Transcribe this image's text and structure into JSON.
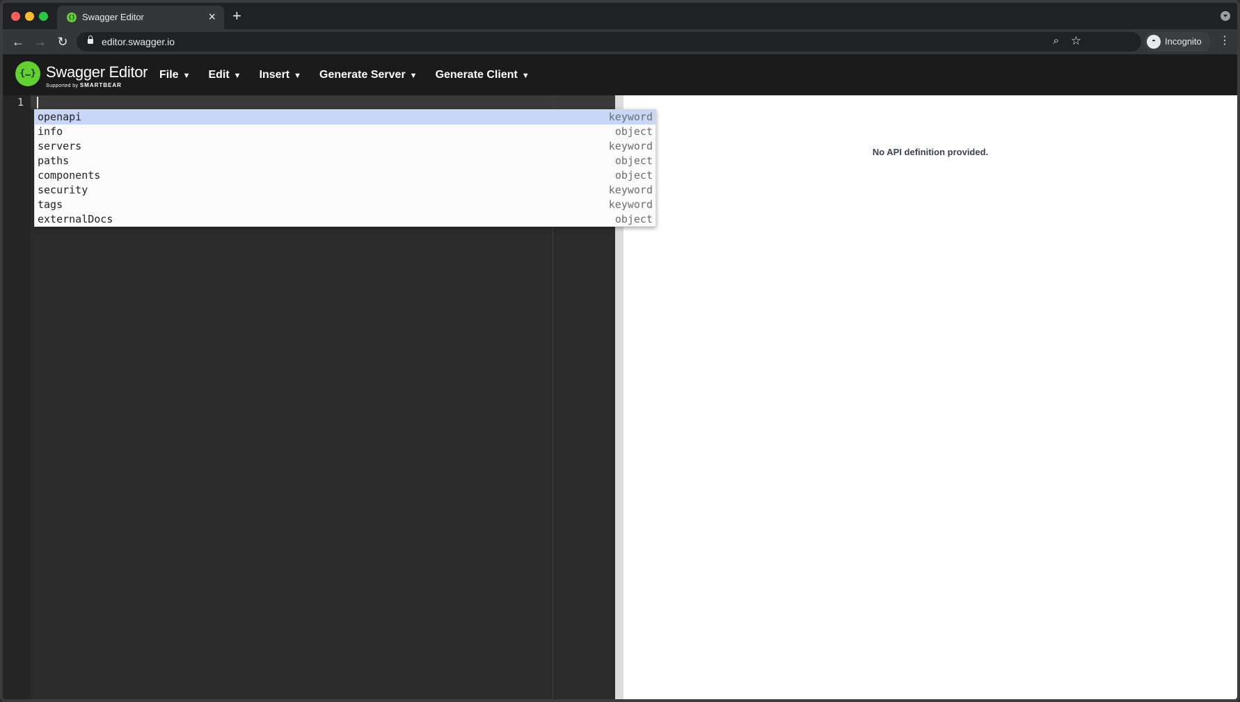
{
  "browser": {
    "tab_title": "Swagger Editor",
    "tab_favicon_glyph": "{}",
    "tab_close_glyph": "×",
    "new_tab_glyph": "+",
    "url": "editor.swagger.io",
    "incognito_label": "Incognito",
    "nav": {
      "back": "←",
      "forward": "→",
      "reload": "↻"
    },
    "zoom_glyph": "⌕",
    "star_glyph": "☆",
    "kebab_glyph": "⋮"
  },
  "swagger": {
    "logo_glyph": "{…}",
    "brand_name": "Swagger Editor",
    "brand_sub_prefix": "Supported by",
    "brand_sub_company": "SMARTBEAR",
    "menu": [
      {
        "label": "File"
      },
      {
        "label": "Edit"
      },
      {
        "label": "Insert"
      },
      {
        "label": "Generate Server"
      },
      {
        "label": "Generate Client"
      }
    ],
    "caret": "▼"
  },
  "editor": {
    "line_number": "1",
    "autocomplete": [
      {
        "name": "openapi",
        "meta": "keyword",
        "selected": true
      },
      {
        "name": "info",
        "meta": "object",
        "selected": false
      },
      {
        "name": "servers",
        "meta": "keyword",
        "selected": false
      },
      {
        "name": "paths",
        "meta": "object",
        "selected": false
      },
      {
        "name": "components",
        "meta": "object",
        "selected": false
      },
      {
        "name": "security",
        "meta": "keyword",
        "selected": false
      },
      {
        "name": "tags",
        "meta": "keyword",
        "selected": false
      },
      {
        "name": "externalDocs",
        "meta": "object",
        "selected": false
      }
    ]
  },
  "preview": {
    "message": "No API definition provided."
  },
  "colors": {
    "swagger_green": "#62d130",
    "topbar_bg": "#1b1b1b",
    "editor_bg": "#2b2b2b",
    "selected_row": "#c8d7f7"
  }
}
